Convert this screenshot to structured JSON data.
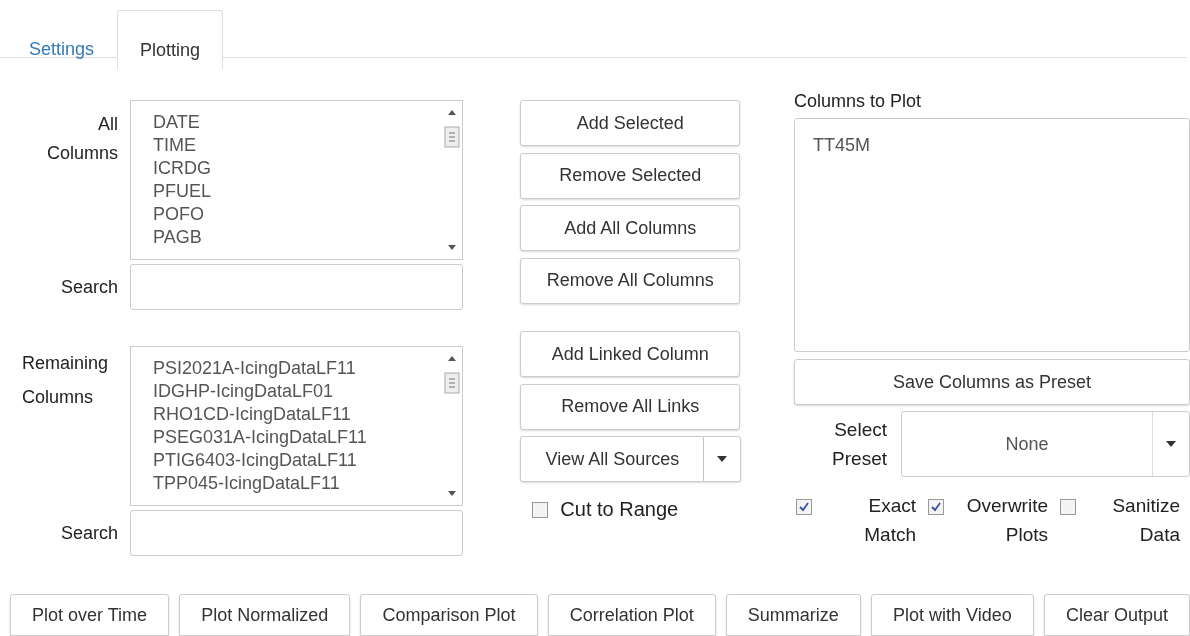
{
  "tabs": [
    {
      "label": "Settings",
      "selected": false
    },
    {
      "label": "Plotting",
      "selected": true
    }
  ],
  "all_columns": {
    "label": "All Columns",
    "items": [
      "DATE",
      "TIME",
      "ICRDG",
      "PFUEL",
      "POFO",
      "PAGB"
    ],
    "search_label": "Search"
  },
  "remaining_columns": {
    "label": "Remaining Columns",
    "items": [
      "PSI2021A-IcingDataLF11",
      "IDGHP-IcingDataLF01",
      "RHO1CD-IcingDataLF11",
      "PSEG031A-IcingDataLF11",
      "PTIG6403-IcingDataLF11",
      "TPP045-IcingDataLF11"
    ],
    "search_label": "Search"
  },
  "column_buttons": [
    "Add Selected",
    "Remove Selected",
    "Add All Columns",
    "Remove All Columns"
  ],
  "link_buttons": [
    "Add Linked Column",
    "Remove All Links"
  ],
  "view_sources": {
    "label": "View All Sources"
  },
  "cut_to_range": {
    "label": "Cut to Range",
    "checked": false
  },
  "columns_to_plot": {
    "label": "Columns to Plot",
    "value": "TT45M"
  },
  "save_preset": "Save Columns as Preset",
  "select_preset": {
    "label": "Select Preset",
    "value": "None"
  },
  "options": [
    {
      "label": "Exact Match",
      "checked": true
    },
    {
      "label": "Overwrite Plots",
      "checked": true
    },
    {
      "label": "Sanitize Data",
      "checked": false
    }
  ],
  "actions": [
    "Plot over Time",
    "Plot Normalized",
    "Comparison Plot",
    "Correlation Plot",
    "Summarize",
    "Plot with Video",
    "Clear Output"
  ]
}
